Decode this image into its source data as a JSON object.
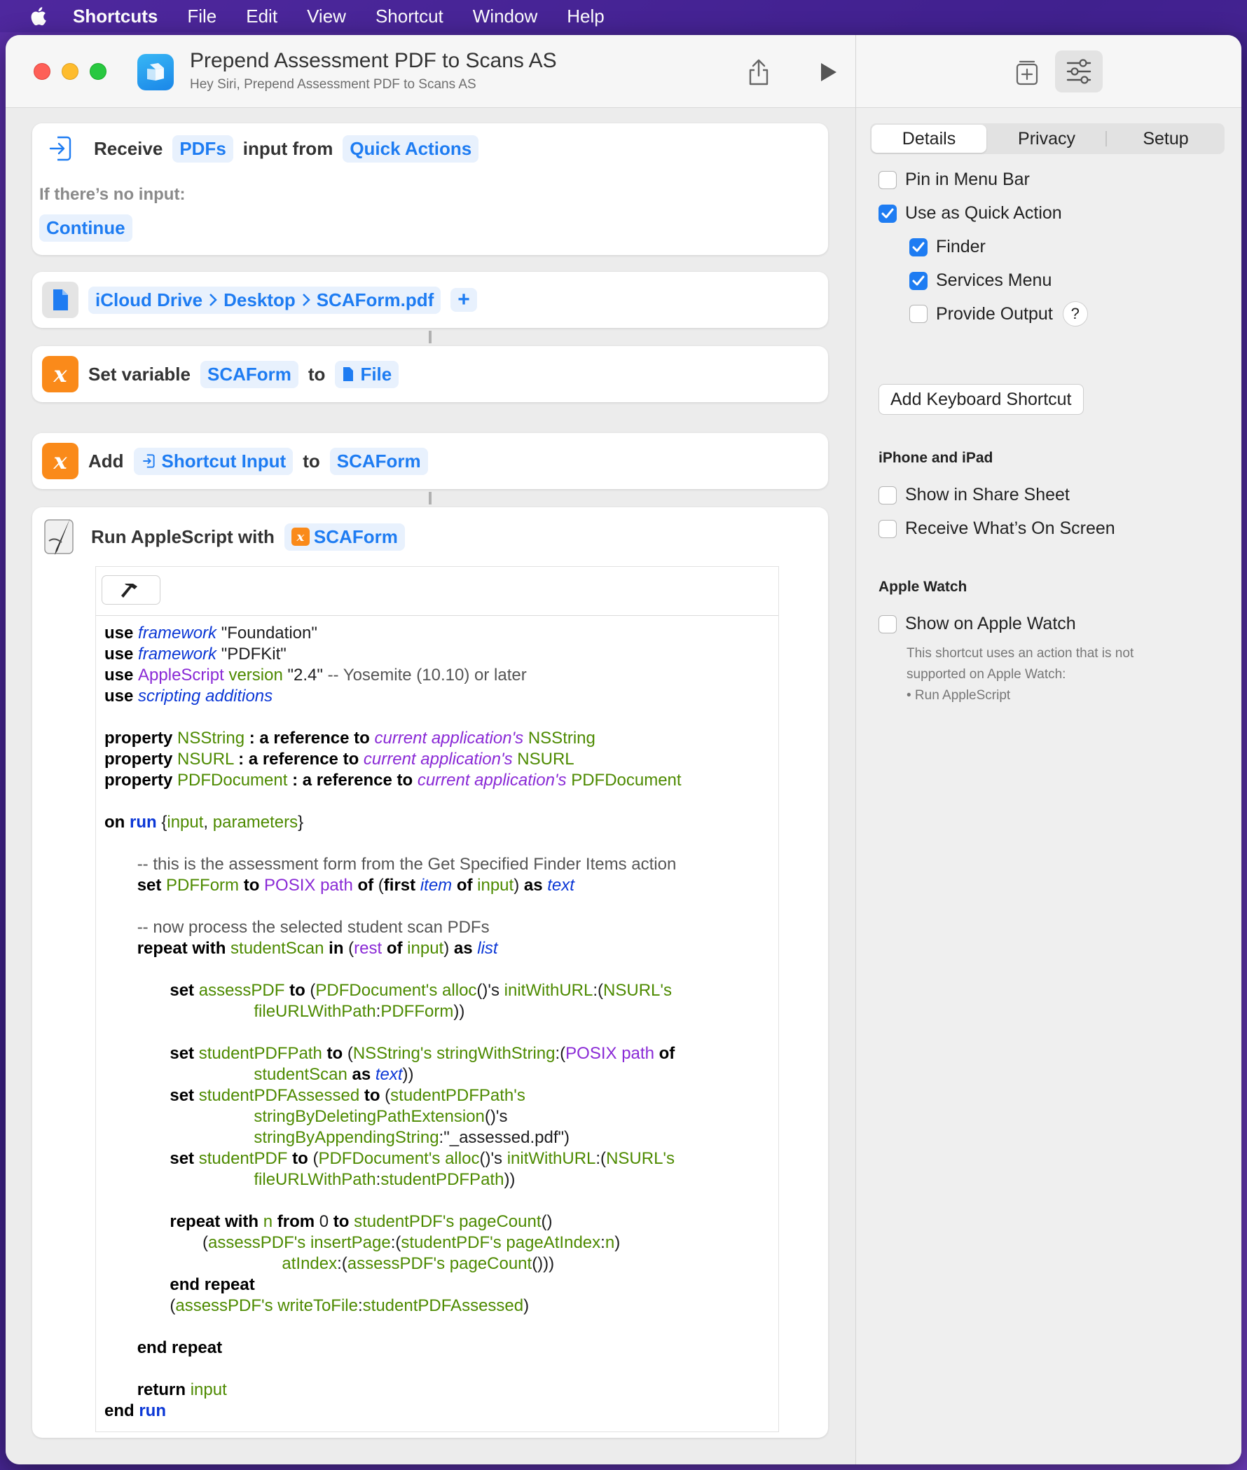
{
  "menubar": {
    "app": "Shortcuts",
    "items": [
      "File",
      "Edit",
      "View",
      "Shortcut",
      "Window",
      "Help"
    ]
  },
  "window": {
    "title": "Prepend Assessment PDF to Scans AS",
    "subtitle": "Hey Siri, Prepend Assessment PDF to Scans AS"
  },
  "actions": {
    "receive": {
      "verb": "Receive",
      "type": "PDFs",
      "mid": "input from",
      "source": "Quick Actions",
      "no_input_label": "If there’s no input:",
      "no_input_action": "Continue"
    },
    "file": {
      "path": [
        "iCloud Drive",
        "Desktop",
        "SCAForm.pdf"
      ],
      "add": "+"
    },
    "set_var": {
      "verb": "Set variable",
      "name": "SCAForm",
      "to": "to",
      "value": "File"
    },
    "add_var": {
      "verb": "Add",
      "input": "Shortcut Input",
      "to": "to",
      "target": "SCAForm"
    },
    "applescript": {
      "label": "Run AppleScript with",
      "var": "SCAForm",
      "var_icon": "x"
    }
  },
  "sidebar": {
    "tabs": [
      "Details",
      "Privacy",
      "Setup"
    ],
    "active_tab": "Details",
    "options": {
      "pin_menu_bar": {
        "label": "Pin in Menu Bar",
        "checked": false
      },
      "quick_action": {
        "label": "Use as Quick Action",
        "checked": true
      },
      "finder": {
        "label": "Finder",
        "checked": true
      },
      "services_menu": {
        "label": "Services Menu",
        "checked": true
      },
      "provide_output": {
        "label": "Provide Output",
        "checked": false
      },
      "help": "?"
    },
    "keyboard_button": "Add Keyboard Shortcut",
    "iphone_section": "iPhone and iPad",
    "share_sheet": {
      "label": "Show in Share Sheet",
      "checked": false
    },
    "on_screen": {
      "label": "Receive What’s On Screen",
      "checked": false
    },
    "watch_section": "Apple Watch",
    "show_watch": {
      "label": "Show on Apple Watch",
      "checked": false
    },
    "watch_note": [
      "This shortcut uses an action that is not",
      "supported on Apple Watch:",
      "• Run AppleScript"
    ]
  },
  "colors": {
    "accent": "#1e7cf2",
    "variable_orange": "#fa8a1a",
    "desktop_purple": "#4a27a0"
  },
  "icons": [
    "apple-icon",
    "shortcuts-app-icon",
    "share-icon",
    "play-icon",
    "library-icon",
    "settings-sliders-icon",
    "receive-input-icon",
    "file-icon",
    "variable-icon",
    "script-editor-icon",
    "hammer-icon",
    "checkmark-icon",
    "chevron-right-icon"
  ]
}
